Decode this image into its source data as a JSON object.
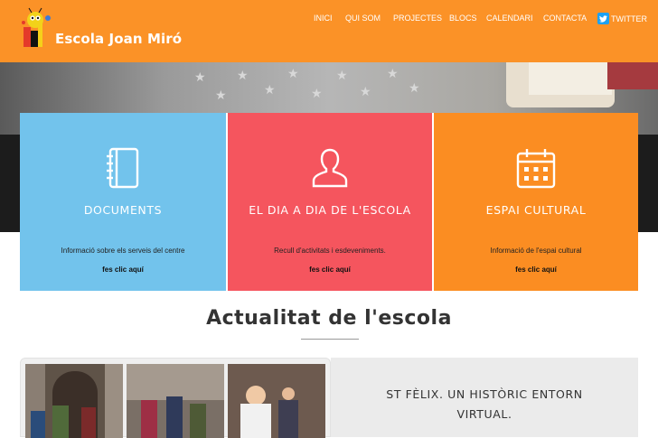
{
  "header": {
    "brand": "Escola Joan Miró",
    "nav": [
      "INICI",
      "QUI SOM",
      "PROJECTES",
      "BLOCS",
      "CALENDARI",
      "CONTACTA"
    ],
    "twitter_label": "TWITTER"
  },
  "cards": [
    {
      "title": "DOCUMENTS",
      "desc": "Informació sobre els serveis del centre",
      "more": "fes clic aquí",
      "icon": "notebook-icon",
      "color": "#72c3ec"
    },
    {
      "title": "EL DIA A DIA DE L'ESCOLA",
      "desc": "Recull d'activitats i esdeveniments.",
      "more": "fes clic aquí",
      "icon": "user-icon",
      "color": "#f5555e"
    },
    {
      "title": "ESPAI CULTURAL",
      "desc": "Informació de l'espai cultural",
      "more": "fes clic aquí",
      "icon": "calendar-icon",
      "color": "#fb8d22"
    }
  ],
  "section": {
    "title": "Actualitat de l'escola"
  },
  "news": {
    "headline_line1": "ST FÈLIX. UN HISTÒRIC ENTORN",
    "headline_line2": "VIRTUAL."
  },
  "colors": {
    "header": "#fb9227",
    "twitter": "#1da1f2"
  }
}
